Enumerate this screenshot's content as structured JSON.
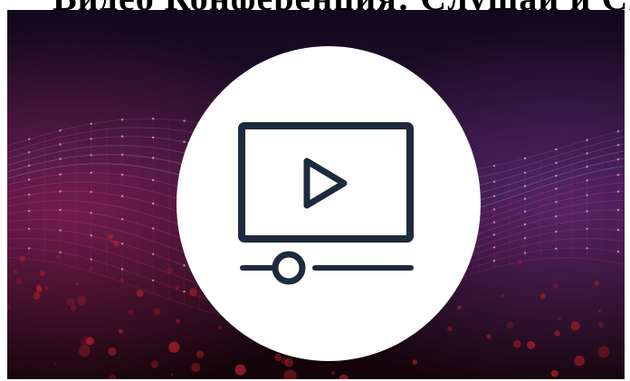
{
  "header": {
    "cutoff_text": "Видео Конференция: Слушай и Смотри Групповой Курс"
  },
  "hero": {
    "icon": "video-player-icon",
    "play_state": "paused",
    "progress": 0.2,
    "colors": {
      "background": "#15091a",
      "badge": "#ffffff",
      "icon_stroke": "#1e2a3d",
      "mesh_pink": "#e0337e",
      "mesh_blue": "#8fb8e0",
      "particles_red": "#b3202a"
    }
  }
}
